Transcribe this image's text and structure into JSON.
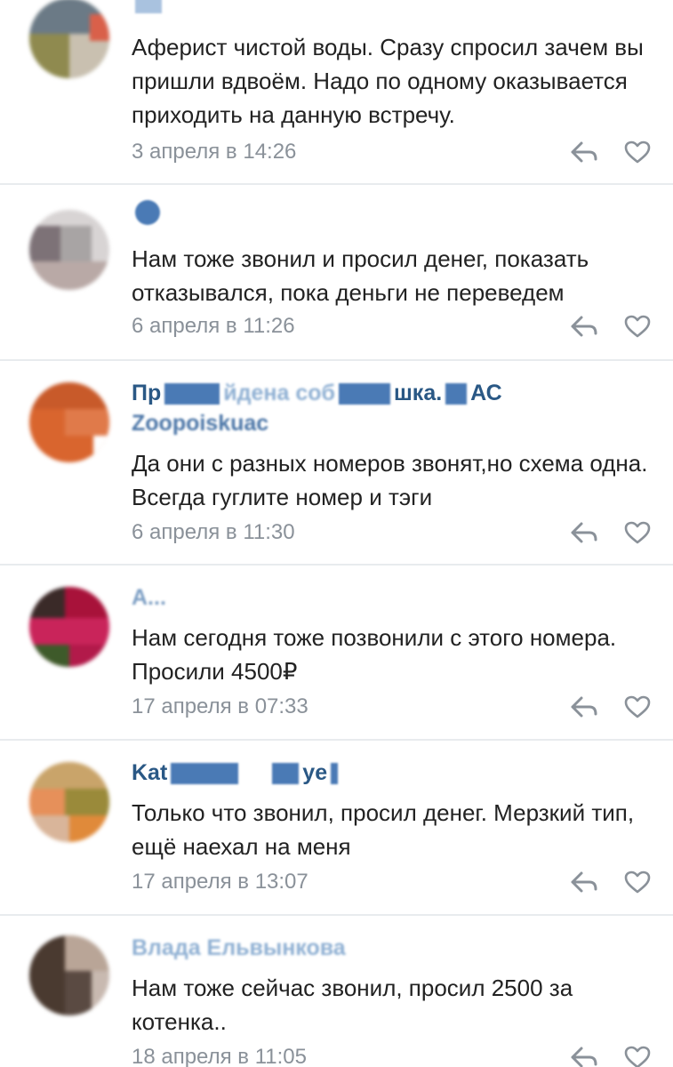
{
  "comments": [
    {
      "author_visible": "",
      "text": "Аферист чистой воды. Сразу спросил зачем вы пришли вдвоём. Надо по одному оказывается приходить на данную встречу.",
      "date": "3 апреля в 14:26"
    },
    {
      "author_visible": "",
      "text": "Нам тоже звонил и просил денег, показать отказывался, пока деньги не переведем",
      "date": "6 апреля в 11:26"
    },
    {
      "author_visible_a": "Пр",
      "author_visible_b": "йдена соб",
      "author_visible_c": "шка.",
      "author_visible_d": "АС",
      "author_line2": "Zoopoiskuac",
      "text": "Да они с разных номеров звонят,но схема одна. Всегда гуглите номер и тэги",
      "date": "6 апреля в 11:30"
    },
    {
      "author_visible": "А...",
      "text": "Нам сегодня тоже позвонили с этого номера. Просили 4500₽",
      "date": "17 апреля в 07:33"
    },
    {
      "author_visible_a": "Kat",
      "author_visible_b": "ye",
      "text": "Только что звонил, просил денег. Мерзкий тип, ещё наехал на меня",
      "date": "17 апреля в 13:07"
    },
    {
      "author_visible": "Влада Ельвынкова",
      "text": "Нам тоже сейчас звонил, просил 2500 за котенка..",
      "date": "18 апреля в 11:05"
    }
  ],
  "icons": {
    "reply": "reply-icon",
    "like": "heart-icon"
  },
  "colors": {
    "author": "#2a5885",
    "date": "#8a9199",
    "icon": "#8a9199",
    "divider": "#e8ebee"
  }
}
